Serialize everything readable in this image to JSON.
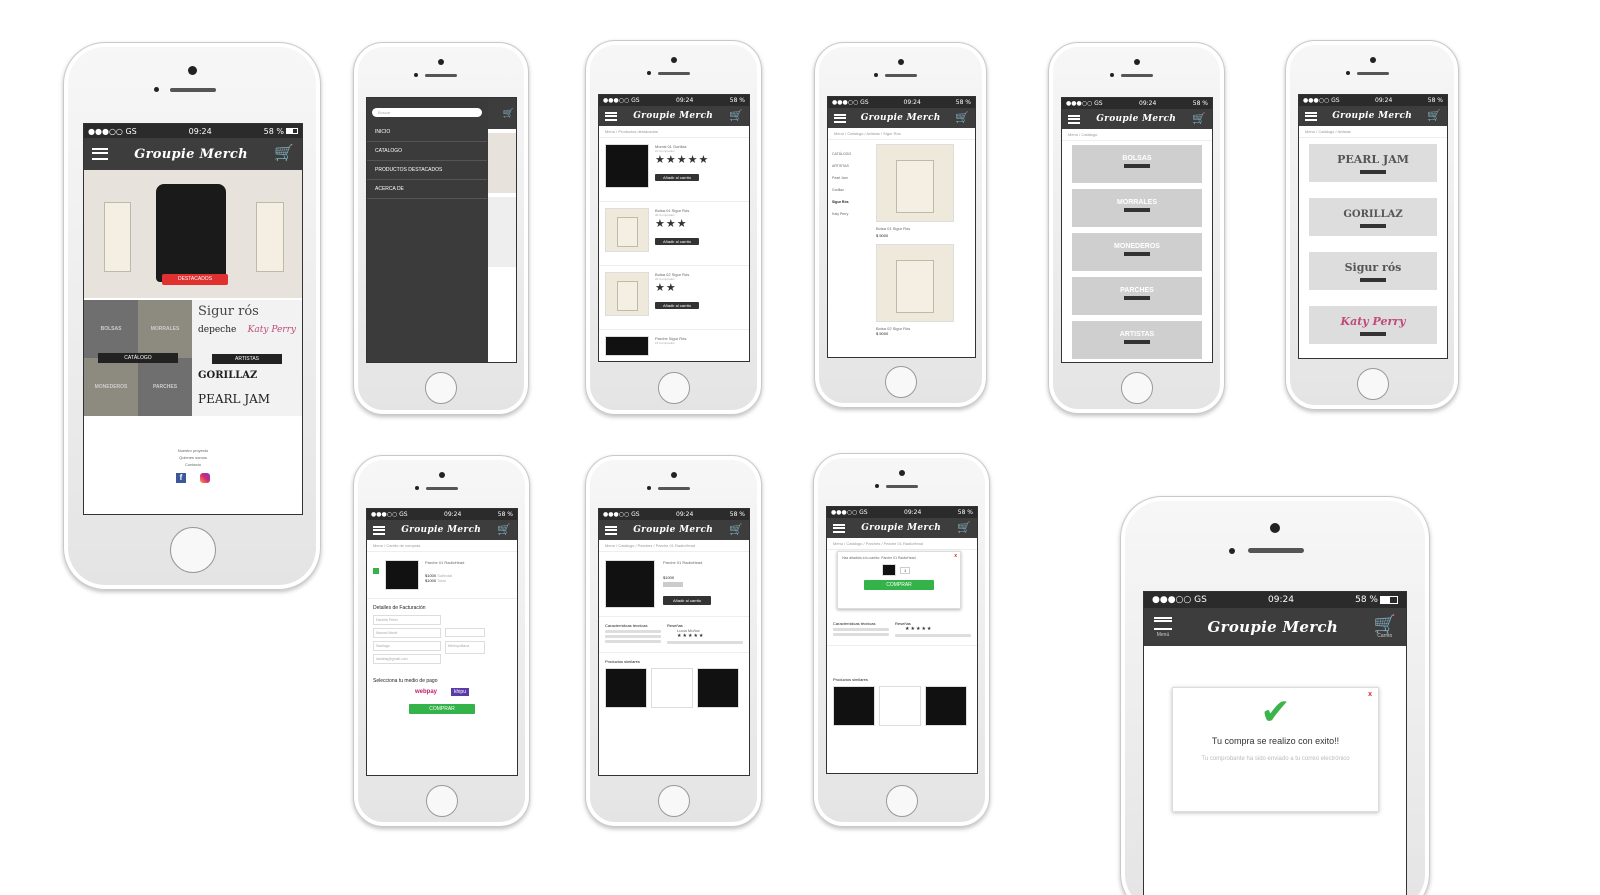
{
  "app": {
    "title": "Groupie Merch",
    "menu_label": "Menú",
    "cart_label": "Carrito"
  },
  "status": {
    "carrier": "●●●○○ GS",
    "time": "09:24",
    "battery": "58 %"
  },
  "home": {
    "badge": "DESTACADOS",
    "catalog_label": "CATÁLOGO",
    "artists_label": "ARTISTAS",
    "tiles": [
      "BOLSAS",
      "MORRALES",
      "MONEDEROS",
      "PARCHES"
    ],
    "footer": [
      "Nuestro proyecto",
      "Quienes somos",
      "Contacto"
    ],
    "artist_logos": [
      "Sigur rós",
      "depeche",
      "Katy Perry",
      "GORILLAZ",
      "PEARL JAM"
    ]
  },
  "menu": {
    "search_placeholder": "Buscar",
    "items": [
      "INICIO",
      "CATALOGO",
      "PRODUCTOS DESTACADOS",
      "ACERCA DE"
    ]
  },
  "featured": {
    "crumb": "Menú / Productos destacados",
    "add_label": "Añadir al carrito",
    "items": [
      {
        "name": "Morral 01 Gorillaz",
        "sub": "10 Comprados",
        "stars": "★★★★★"
      },
      {
        "name": "Bolsa 01 Sigur Rós",
        "sub": "40 Comprados",
        "stars": "★★★"
      },
      {
        "name": "Bolsa 02 Sigur Rós",
        "sub": "20 Comprados",
        "stars": "★★"
      },
      {
        "name": "Parche Sigur Rós",
        "sub": "15 Comprados",
        "stars": ""
      }
    ]
  },
  "sigur": {
    "crumb": "Menú / Catálogo / Artistas / Sigur Rós",
    "filters": [
      "CATÁLOGO",
      "ARTISTAS",
      "Pearl Jam",
      "Gorillaz",
      "Sigur Rós",
      "Katy Perry"
    ],
    "items": [
      {
        "name": "Bolsa 01 Sigur Rós",
        "price": "$ 5000"
      },
      {
        "name": "Bolsa 02 Sigur Rós",
        "price": "$ 5000"
      }
    ]
  },
  "catalog": {
    "crumb": "Menú / Catálogo",
    "tiles": [
      "BOLSAS",
      "MORRALES",
      "MONEDEROS",
      "PARCHES",
      "ARTISTAS"
    ],
    "ver": "ver"
  },
  "artists": {
    "crumb": "Menú / Catálogo / Artistas",
    "logos": [
      "PEARL JAM",
      "GORILLAZ",
      "Sigur rós",
      "Katy Perry"
    ],
    "ver": "ver"
  },
  "cart": {
    "crumb": "Menú / Carrito de compras",
    "product": "Parche 01 RadioHead",
    "subtotal": "$1000",
    "total": "$1000",
    "subtotal_label": "Subtotal",
    "total_label": "Total",
    "billing": "Detalles de Facturación",
    "fields": [
      "Daniela Pérez",
      "Manuel Montt",
      "Santiago",
      "Metropolitana",
      "danielaj@gmail.com"
    ],
    "payment": "Selecciona tu medio de pago",
    "pay1": "webpay",
    "pay2": "khipu",
    "buy": "COMPRAR"
  },
  "product": {
    "crumb": "Menú / Catálogo / Parches / Parche 01 RadioHead",
    "name": "Parche 01 RadioHead",
    "price": "$1000",
    "add": "Añadir al carrito",
    "specs": "Características técnicas",
    "reviews": "Reseñas",
    "similar": "Productos similares",
    "reviewer": "Lucía Muñoz"
  },
  "added": {
    "msg": "Has añadido a tu carrito: Parche 01 RadioHead",
    "qty": "1",
    "buy": "COMPRAR"
  },
  "success": {
    "message": "Tu compra se realizo con exito!!",
    "sub": "Tu comprobante ha sido enviado a tu correo electrónico",
    "close": "x"
  }
}
